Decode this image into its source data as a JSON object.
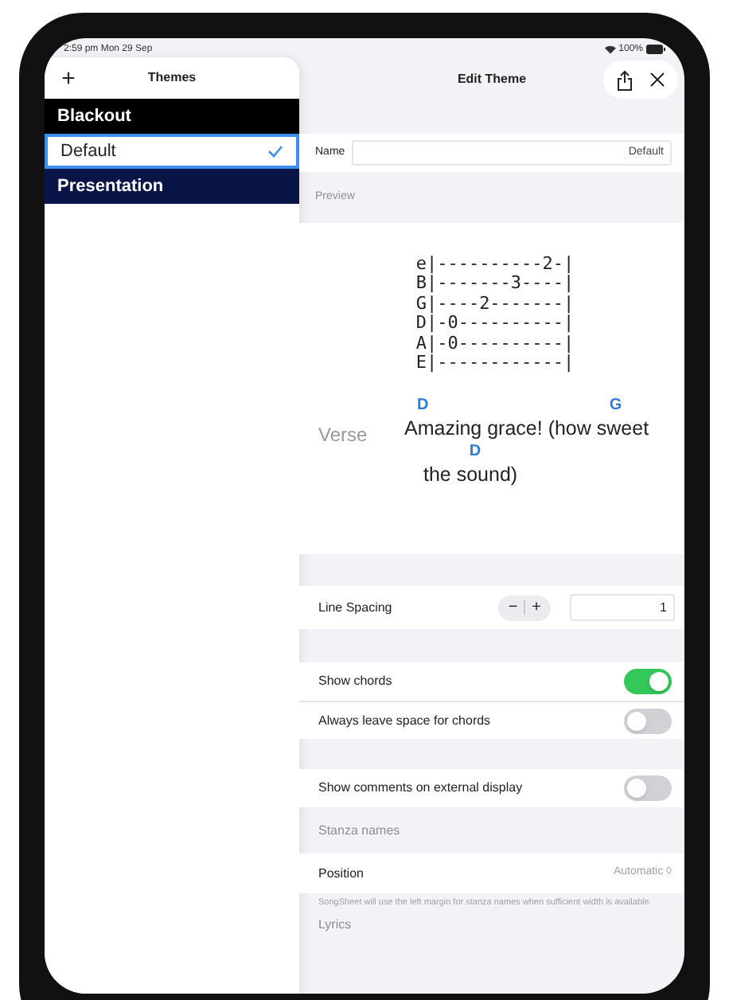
{
  "status_bar": {
    "time": "2:59 pm  Mon 29 Sep",
    "battery": "100%"
  },
  "sidebar": {
    "add_button": "+",
    "title": "Themes",
    "items": [
      {
        "label": "Blackout",
        "color": "#000000",
        "selected": false
      },
      {
        "label": "Default",
        "color": "#ffffff",
        "selected": true
      },
      {
        "label": "Presentation",
        "color": "#0a1547",
        "selected": false
      }
    ]
  },
  "editor": {
    "title": "Edit Theme",
    "name_label": "Name",
    "name_value": "Default",
    "preview_label": "Preview",
    "tab_lines": [
      "e|----------2-|",
      "B|-------3----|",
      "G|----2-------|",
      "D|-0----------|",
      "A|-0----------|",
      "E|------------|"
    ],
    "stanza_label": "Verse",
    "lyric_lines": [
      [
        {
          "chord": "D",
          "text": "Amazing grace! (how "
        },
        {
          "chord": "G",
          "text": "sweet"
        }
      ],
      [
        {
          "text": "the "
        },
        {
          "chord": "D",
          "text": "sound)"
        }
      ]
    ],
    "line_spacing": {
      "label": "Line Spacing",
      "minus": "−",
      "plus": "+",
      "value": "1"
    },
    "toggles_1": [
      {
        "label": "Show chords",
        "on": true
      },
      {
        "label": "Always leave space for chords",
        "on": false
      }
    ],
    "toggles_2": [
      {
        "label": "Show comments on external display",
        "on": false
      }
    ],
    "stanza_section": "Stanza names",
    "position_label": "Position",
    "position_value": "Automatic ◊",
    "footnote": "SongSheet will use the left margin for stanza names when sufficient width is available.",
    "lyrics_section": "Lyrics"
  }
}
